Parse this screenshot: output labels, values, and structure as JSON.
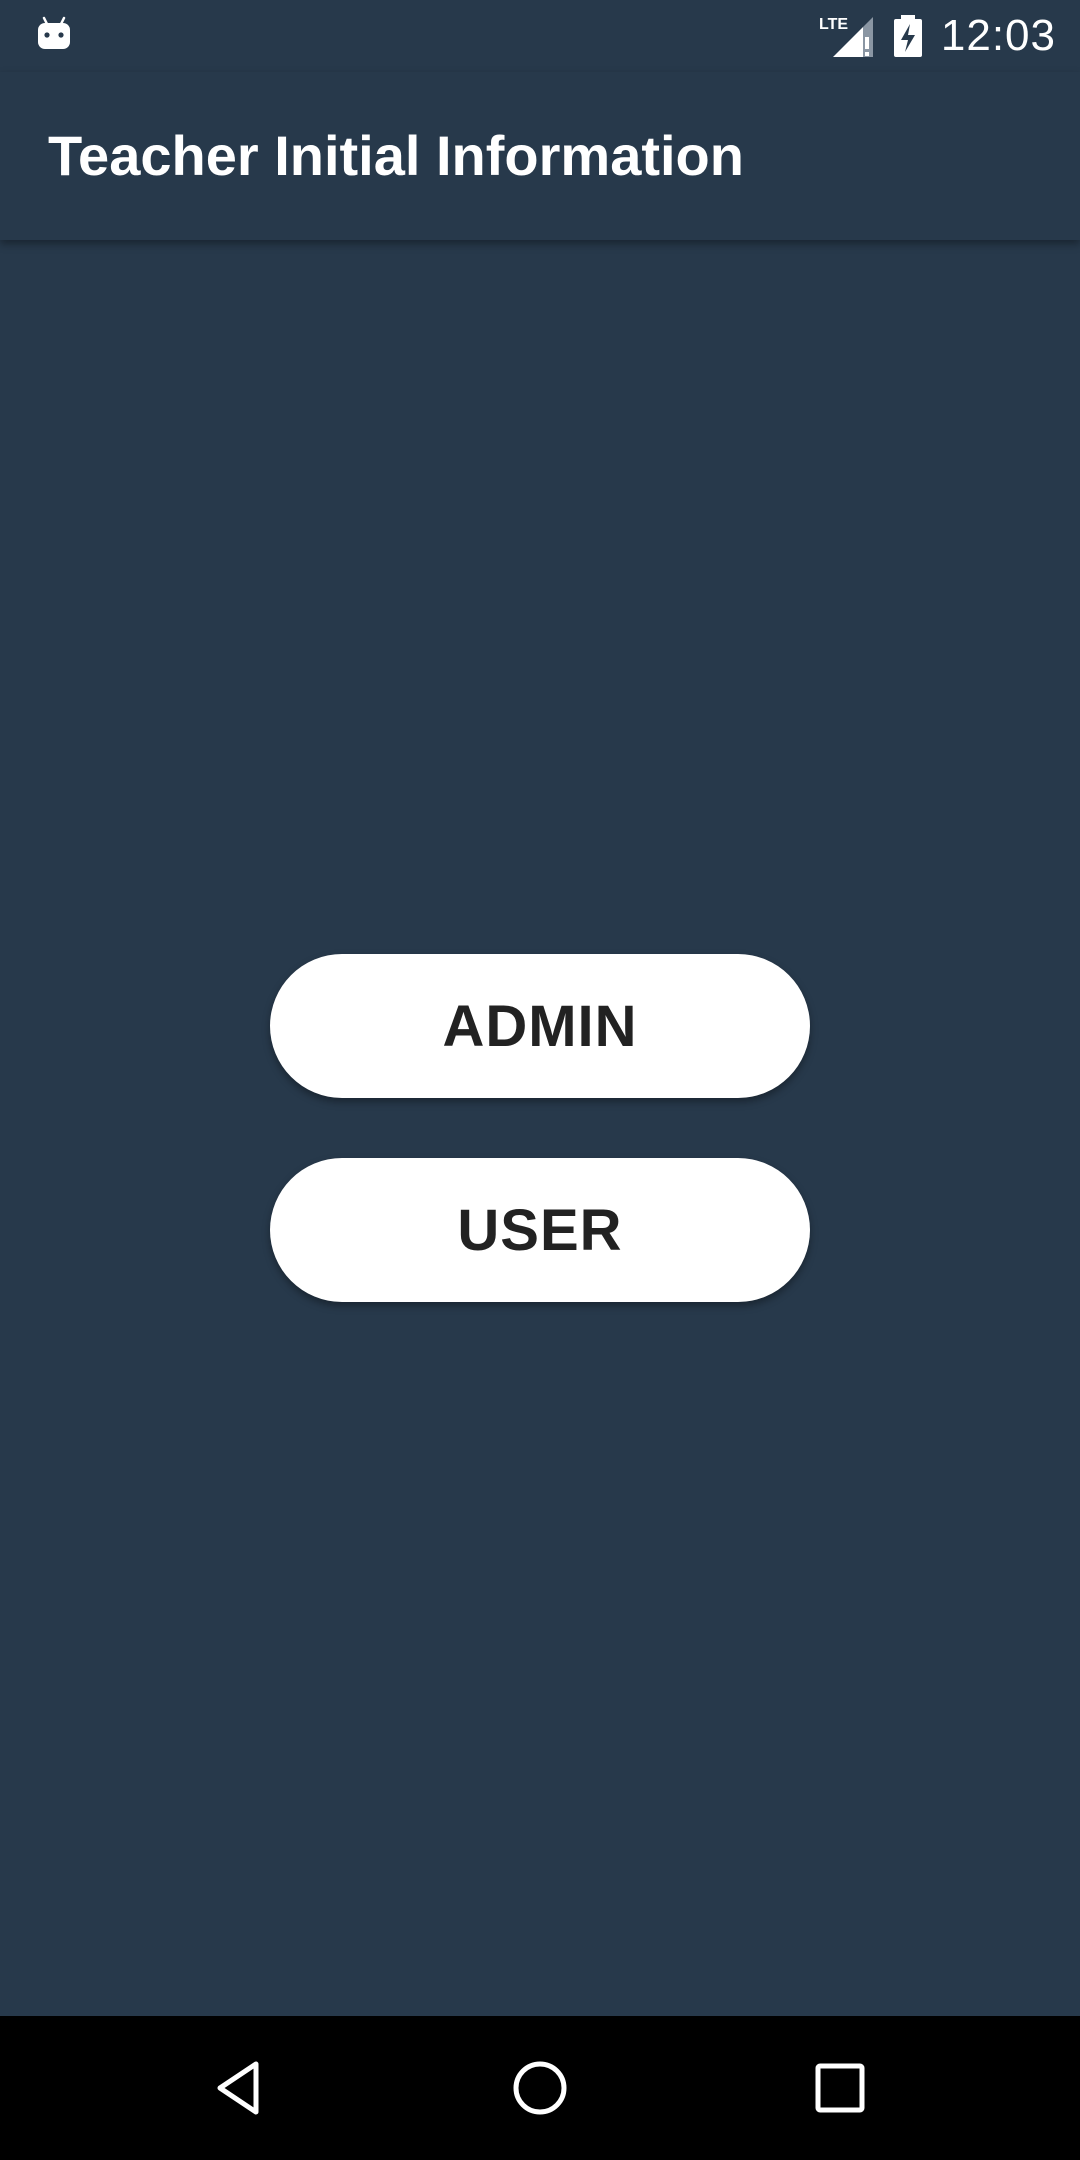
{
  "status_bar": {
    "time": "12:03",
    "network_label": "LTE",
    "icons": [
      "android-icon",
      "lte-signal-icon",
      "battery-charging-icon"
    ]
  },
  "app_bar": {
    "title": "Teacher Initial Information"
  },
  "main": {
    "buttons": [
      {
        "label": "ADMIN"
      },
      {
        "label": "USER"
      }
    ]
  },
  "nav_bar": {
    "icons": [
      "back-icon",
      "home-icon",
      "recents-icon"
    ]
  },
  "colors": {
    "background": "#27394b",
    "button_bg": "#ffffff",
    "button_text": "#222222",
    "nav_bg": "#000000"
  }
}
